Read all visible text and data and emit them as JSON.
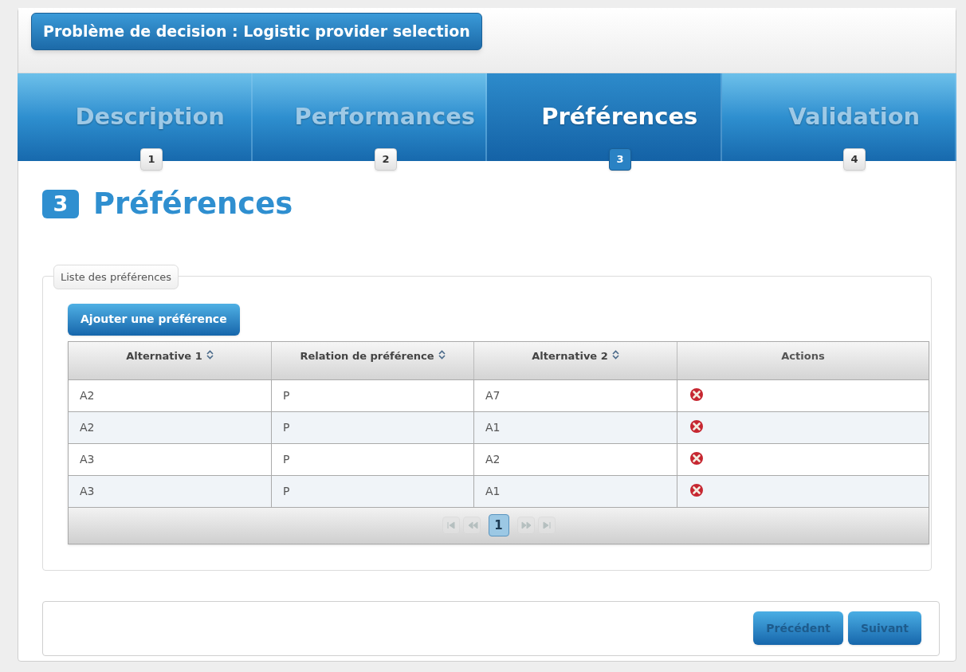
{
  "title": "Problème de decision : Logistic provider selection",
  "steps": [
    {
      "label": "Description",
      "number": "1",
      "selected": false
    },
    {
      "label": "Performances",
      "number": "2",
      "selected": false
    },
    {
      "label": "Préférences",
      "number": "3",
      "selected": true
    },
    {
      "label": "Validation",
      "number": "4",
      "selected": false
    }
  ],
  "heading": {
    "number": "3",
    "text": "Préférences"
  },
  "fieldset": {
    "legend": "Liste des préférences",
    "add_button": "Ajouter une préférence"
  },
  "table": {
    "columns": [
      {
        "label": "Alternative 1",
        "sortable": true
      },
      {
        "label": "Relation de préférence",
        "sortable": true
      },
      {
        "label": "Alternative 2",
        "sortable": true
      },
      {
        "label": "Actions",
        "sortable": false
      }
    ],
    "rows": [
      [
        "A2",
        "P",
        "A7"
      ],
      [
        "A2",
        "P",
        "A1"
      ],
      [
        "A3",
        "P",
        "A2"
      ],
      [
        "A3",
        "P",
        "A1"
      ]
    ],
    "pages": [
      {
        "label": "1",
        "selected": true
      }
    ]
  },
  "footer": {
    "buttons": [
      {
        "label": "Précédent",
        "disabled": true
      },
      {
        "label": "Suivant",
        "disabled": true
      }
    ]
  }
}
